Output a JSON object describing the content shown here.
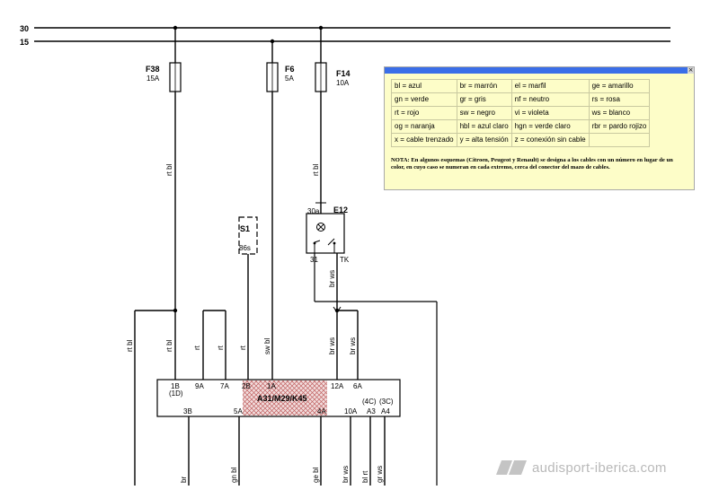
{
  "buses": {
    "top": "30",
    "bottom": "15"
  },
  "fuses": [
    {
      "id": "F38",
      "rating": "15A"
    },
    {
      "id": "F6",
      "rating": "5A"
    },
    {
      "id": "F14",
      "rating": "10A"
    }
  ],
  "switch_s1": {
    "id": "S1",
    "terminal": "86s"
  },
  "component_e12": {
    "id": "E12",
    "pin_in": "30a",
    "pin_gnd": "31",
    "pin_tk": "TK"
  },
  "module": {
    "label": "A31/M29/K45",
    "top_pins": [
      "1B",
      "9A",
      "7A",
      "2B",
      "1A",
      "12A",
      "6A"
    ],
    "alt_pin_1": "(1D)",
    "bottom_pins": [
      "3B",
      "5A",
      "4A",
      "10A",
      "A3",
      "A4"
    ],
    "alt_pin_a3": "(4C)",
    "alt_pin_a4": "(3C)"
  },
  "wires": {
    "f38_out": "rt bl",
    "f14_out": "rt bl",
    "e12_out": "br ws",
    "left_feed": "rt bl",
    "pin1b": "rt bl",
    "pin9a": "rt",
    "pin7a": "rt",
    "pin2b": "rt",
    "pin1a": "sw bl",
    "pin12a": "br ws",
    "pin6a": "br ws",
    "pin3b": "br",
    "pin5a": "gn bl",
    "pin4a": "ge bl",
    "pin10a": "br ws",
    "pina3": "bl rt",
    "pina4": "gr ws"
  },
  "legend": {
    "rows": [
      [
        "bl = azul",
        "br = marrón",
        "el = marfil",
        "ge = amarillo"
      ],
      [
        "gn = verde",
        "gr = gris",
        "nf = neutro",
        "rs = rosa"
      ],
      [
        "rt = rojo",
        "sw = negro",
        "vi = violeta",
        "ws = blanco"
      ],
      [
        "og = naranja",
        "hbl = azul claro",
        "hgn = verde claro",
        "rbr = pardo rojizo"
      ],
      [
        "x = cable trenzado",
        "y = alta tensión",
        "z = conexión sin cable",
        ""
      ]
    ],
    "note": "NOTA: En algunos esquemas (Citroen, Peugeot y Renault) se designa a los cables con un número en lugar de un color, en cuyo caso se numeran en cada extremo, cerca del conector del mazo de cables.",
    "close_glyph": "×"
  },
  "watermark": {
    "text": "audisport-iberica.com"
  }
}
